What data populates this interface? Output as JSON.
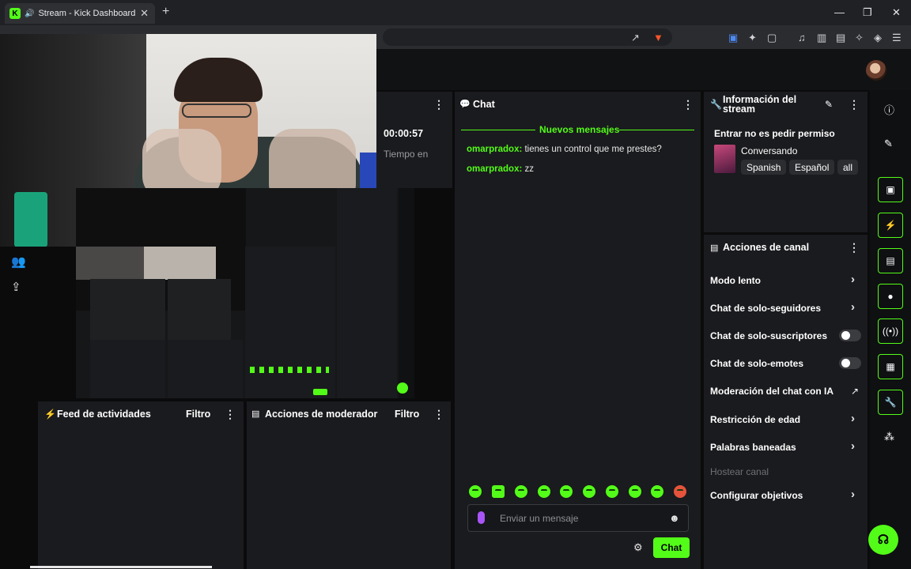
{
  "browser": {
    "tab_title": "Stream - Kick Dashboard",
    "favicon_letter": "K",
    "new_tab": "+",
    "window_controls": [
      "—",
      "❐",
      "✕"
    ]
  },
  "stream_stats": {
    "uptime": "00:00:57",
    "uptime_label": "Tiempo en"
  },
  "chat": {
    "title": "Chat",
    "divider_label": "Nuevos mensajes",
    "messages": [
      {
        "user": "omarpradox:",
        "text": " tienes un control que me prestes?"
      },
      {
        "user": "omarpradox:",
        "text": " zz"
      }
    ],
    "input_placeholder": "Enviar un mensaje",
    "send_label": "Chat"
  },
  "stream_info": {
    "title": "Información del stream",
    "stream_title": "Entrar no es pedir permiso",
    "category": "Conversando",
    "tags": [
      "Spanish",
      "Español",
      "all"
    ]
  },
  "channel_actions": {
    "title": "Acciones de canal",
    "items": [
      {
        "label": "Modo lento",
        "control": "chevron"
      },
      {
        "label": "Chat de solo-seguidores",
        "control": "chevron"
      },
      {
        "label": "Chat de solo-suscriptores",
        "control": "toggle",
        "on": false
      },
      {
        "label": "Chat de solo-emotes",
        "control": "toggle",
        "on": false
      },
      {
        "label": "Moderación del chat con IA",
        "control": "external"
      },
      {
        "label": "Restricción de edad",
        "control": "chevron"
      },
      {
        "label": "Palabras baneadas",
        "control": "chevron"
      },
      {
        "label": "Hostear canal",
        "control": "disabled"
      },
      {
        "label": "Configurar objetivos",
        "control": "chevron"
      }
    ]
  },
  "activity_feed": {
    "title": "Feed de actividades",
    "filter": "Filtro"
  },
  "mod_actions": {
    "title": "Acciones de moderador",
    "filter": "Filtro"
  },
  "colors": {
    "accent": "#53fc18",
    "panel": "#1a1b1e",
    "background": "#0b0b0c"
  }
}
